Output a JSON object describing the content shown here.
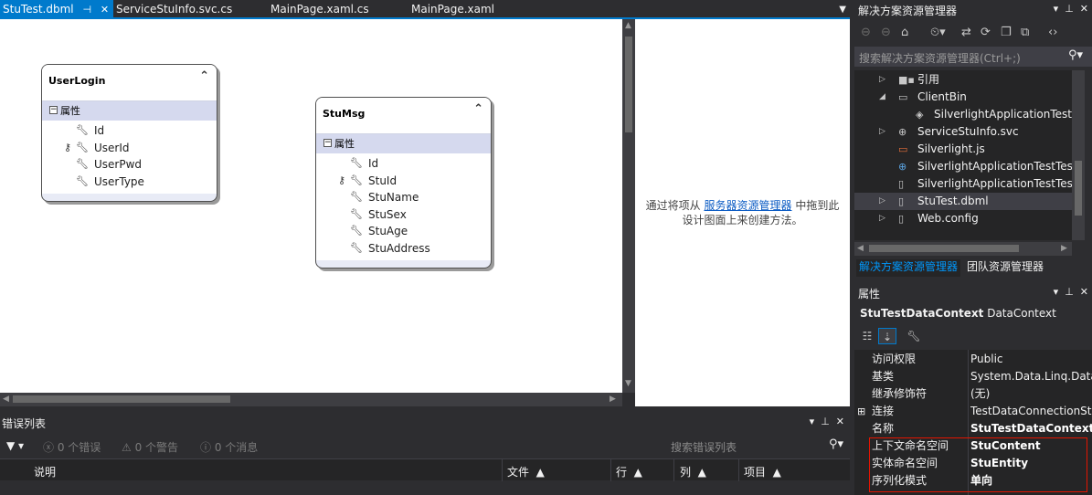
{
  "doc_tabs": [
    {
      "label": "StuTest.dbml",
      "active": true
    },
    {
      "label": "ServiceStuInfo.svc.cs",
      "active": false
    },
    {
      "label": "MainPage.xaml.cs",
      "active": false
    },
    {
      "label": "MainPage.xaml",
      "active": false
    }
  ],
  "tab_glyphs": {
    "pin": "⊣",
    "close": "✕",
    "overflow": "▼"
  },
  "designer": {
    "entities": [
      {
        "title": "UserLogin",
        "props_label": "属性",
        "properties": [
          {
            "name": "Id",
            "key": false
          },
          {
            "name": "UserId",
            "key": true
          },
          {
            "name": "UserPwd",
            "key": false
          },
          {
            "name": "UserType",
            "key": false
          }
        ]
      },
      {
        "title": "StuMsg",
        "props_label": "属性",
        "properties": [
          {
            "name": "Id",
            "key": false
          },
          {
            "name": "StuId",
            "key": true
          },
          {
            "name": "StuName",
            "key": false
          },
          {
            "name": "StuSex",
            "key": false
          },
          {
            "name": "StuAge",
            "key": false
          },
          {
            "name": "StuAddress",
            "key": false
          }
        ]
      }
    ],
    "hint_before": "通过将项从 ",
    "hint_link": "服务器资源管理器",
    "hint_after": " 中拖到此",
    "hint_line2": "设计图面上来创建方法。"
  },
  "error_list": {
    "title": "错误列表",
    "errors_label": "0 个错误",
    "warnings_label": "0 个警告",
    "messages_label": "0 个消息",
    "search_placeholder": "搜索错误列表",
    "columns": [
      "说明",
      "文件",
      "行",
      "列",
      "项目"
    ]
  },
  "solution_explorer": {
    "title": "解决方案资源管理器",
    "search_placeholder": "搜索解决方案资源管理器(Ctrl+;)",
    "tree": [
      {
        "label": "引用",
        "icon": "references-icon",
        "expander": "▷",
        "indent": 1,
        "selected": false
      },
      {
        "label": "ClientBin",
        "icon": "folder-icon",
        "expander": "◢",
        "indent": 1,
        "selected": false
      },
      {
        "label": "SilverlightApplicationTest.x",
        "icon": "xap-icon",
        "expander": "",
        "indent": 2,
        "selected": false
      },
      {
        "label": "ServiceStuInfo.svc",
        "icon": "service-icon",
        "expander": "▷",
        "indent": 1,
        "selected": false
      },
      {
        "label": "Silverlight.js",
        "icon": "js-icon",
        "expander": "",
        "indent": 1,
        "selected": false
      },
      {
        "label": "SilverlightApplicationTestTest",
        "icon": "web-page-icon",
        "expander": "",
        "indent": 1,
        "selected": false
      },
      {
        "label": "SilverlightApplicationTestTest",
        "icon": "html-page-icon",
        "expander": "",
        "indent": 1,
        "selected": false
      },
      {
        "label": "StuTest.dbml",
        "icon": "dbml-icon",
        "expander": "▷",
        "indent": 1,
        "selected": true
      },
      {
        "label": "Web.config",
        "icon": "config-icon",
        "expander": "▷",
        "indent": 1,
        "selected": false
      }
    ],
    "bottom_tabs": [
      {
        "label": "解决方案资源管理器",
        "active": true
      },
      {
        "label": "团队资源管理器",
        "active": false
      }
    ]
  },
  "properties": {
    "title": "属性",
    "object_name": "StuTestDataContext",
    "object_type": "DataContext",
    "rows": [
      {
        "name": "访问权限",
        "value": "Public",
        "bold": false,
        "expandable": false
      },
      {
        "name": "基类",
        "value": "System.Data.Linq.Data",
        "bold": false,
        "expandable": false
      },
      {
        "name": "继承修饰符",
        "value": "(无)",
        "bold": false,
        "expandable": false
      },
      {
        "name": "连接",
        "value": "TestDataConnectionSt",
        "bold": false,
        "expandable": true
      },
      {
        "name": "名称",
        "value": "StuTestDataContext",
        "bold": true,
        "expandable": false
      },
      {
        "name": "上下文命名空间",
        "value": "StuContent",
        "bold": true,
        "expandable": false
      },
      {
        "name": "实体命名空间",
        "value": "StuEntity",
        "bold": true,
        "expandable": false
      },
      {
        "name": "序列化模式",
        "value": "单向",
        "bold": true,
        "expandable": false
      }
    ]
  },
  "colors": {
    "accent": "#007acc",
    "highlight_border": "#e51400",
    "link": "#0c5cc4"
  }
}
